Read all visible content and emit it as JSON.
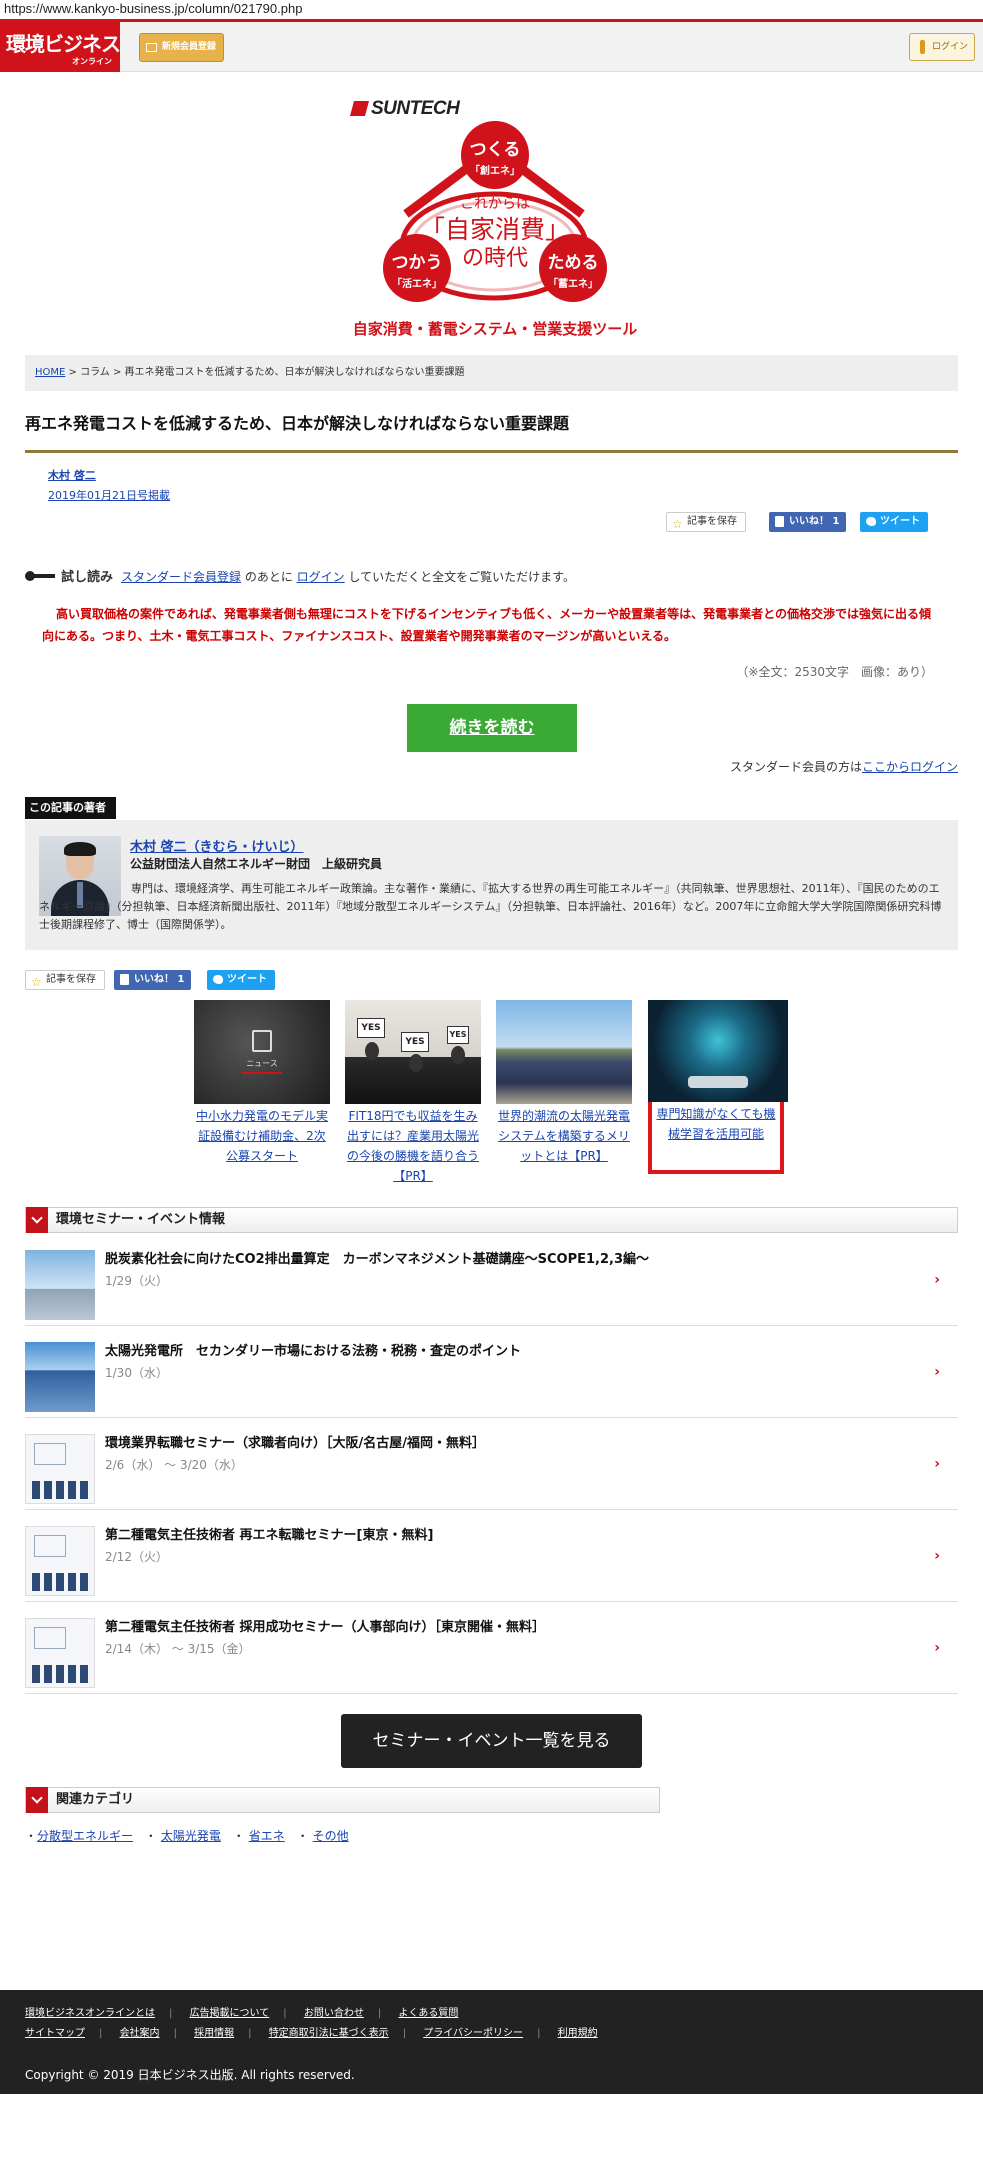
{
  "browser": {
    "url": "https://www.kankyo-business.jp/column/021790.php"
  },
  "header": {
    "logo_main": "環境ビジネス",
    "logo_sub": "オンライン",
    "register_label": "新規会員登録",
    "login_label": "ログイン"
  },
  "banner": {
    "brand": "SUNTECH",
    "circle_top": {
      "main": "つくる",
      "sub": "「創エネ」"
    },
    "circle_left": {
      "main": "つかう",
      "sub": "「活エネ」"
    },
    "circle_right": {
      "main": "ためる",
      "sub": "「蓄エネ」"
    },
    "center_line1": "これからは",
    "center_line2": "「自家消費」",
    "center_line3": "の時代",
    "tagline": "自家消費・蓄電システム・営業支援ツール"
  },
  "breadcrumb": {
    "home": "HOME",
    "sep1": " > ",
    "column": "コラム",
    "sep2": " > ",
    "current": "再エネ発電コストを低減するため、日本が解決しなければならない重要課題"
  },
  "article": {
    "title": "再エネ発電コストを低減するため、日本が解決しなければならない重要課題",
    "author": "木村 啓二",
    "date": "2019年01月21日号掲載",
    "trial_label": "試し読み",
    "trial_link1": "スタンダード会員登録",
    "trial_text1": " のあとに ",
    "trial_link2": "ログイン",
    "trial_text2": " していただくと全文をご覧いただけます。",
    "lead": "高い買取価格の案件であれば、発電事業者側も無理にコストを下げるインセンティブも低く、メーカーや設置業者等は、発電事業者との価格交渉では強気に出る傾向にある。つまり、土木・電気工事コスト、ファイナンスコスト、設置業者や開発事業者のマージンが高いといえる。",
    "count": "（※全文：2530文字　画像：あり）",
    "readmore": "続きを読む",
    "std_text": "スタンダード会員の方は",
    "std_link": "ここからログイン"
  },
  "social": {
    "save": "記事を保存",
    "like": "いいね！ 1",
    "tweet": "ツイート"
  },
  "writer": {
    "heading": "この記事の著者",
    "name": "木村 啓二（きむら・けいじ）",
    "org": "公益財団法人自然エネルギー財団　上級研究員",
    "bio": "専門は、環境経済学、再生可能エネルギー政策論。主な著作・業績に、『拡大する世界の再生可能エネルギー』（共同執筆、世界思想社、2011年）、『国民のためのエネルギー原論』（分担執筆、日本経済新聞出版社、2011年）『地域分散型エネルギーシステム』（分担執筆、日本評論社、2016年）など。2007年に立命館大学大学院国際関係研究科博士後期課程修了、博士（国際関係学）。"
  },
  "related_articles": [
    {
      "image_label": "ニュース",
      "caption": "中小水力発電のモデル実証設備むけ補助金、2次公募スタート"
    },
    {
      "caption": "FIT18円でも収益を生み出すには？産業用太陽光の今後の勝機を語り合う【PR】"
    },
    {
      "caption": "世界的潮流の太陽光発電システムを構築するメリットとは【PR】"
    },
    {
      "caption": "専門知識がなくても機械学習を活用可能"
    }
  ],
  "seminars": {
    "heading": "環境セミナー・イベント情報",
    "items": [
      {
        "title": "脱炭素化社会に向けたCO2排出量算定　カーボンマネジメント基礎講座～SCOPE1,2,3編～",
        "date": "1/29（火）"
      },
      {
        "title": "太陽光発電所　セカンダリー市場における法務・税務・査定のポイント",
        "date": "1/30（水）"
      },
      {
        "title": "環境業界転職セミナー（求職者向け）［大阪/名古屋/福岡・無料］",
        "date": "2/6（水） ～ 3/20（水）"
      },
      {
        "title": "第二種電気主任技術者 再エネ転職セミナー[東京・無料]",
        "date": "2/12（火）"
      },
      {
        "title": "第二種電気主任技術者 採用成功セミナー（人事部向け）［東京開催・無料］",
        "date": "2/14（木） ～ 3/15（金）"
      }
    ],
    "button": "セミナー・イベント一覧を見る"
  },
  "categories": {
    "heading": "関連カテゴリ",
    "items": [
      "分散型エネルギー",
      "太陽光発電",
      "省エネ",
      "その他"
    ]
  },
  "footer": {
    "row1": [
      "環境ビジネスオンラインとは",
      "広告掲載について",
      "お問い合わせ",
      "よくある質問"
    ],
    "row2": [
      "サイトマップ",
      "会社案内",
      "採用情報",
      "特定商取引法に基づく表示",
      "プライバシーポリシー",
      "利用規約"
    ],
    "copyright": "Copyright © 2019 日本ビジネス出版. All rights reserved."
  },
  "colors": {
    "brand_red": "#d0131b",
    "readmore_green": "#3aaa35",
    "rule_olive": "#8b7a3a"
  }
}
